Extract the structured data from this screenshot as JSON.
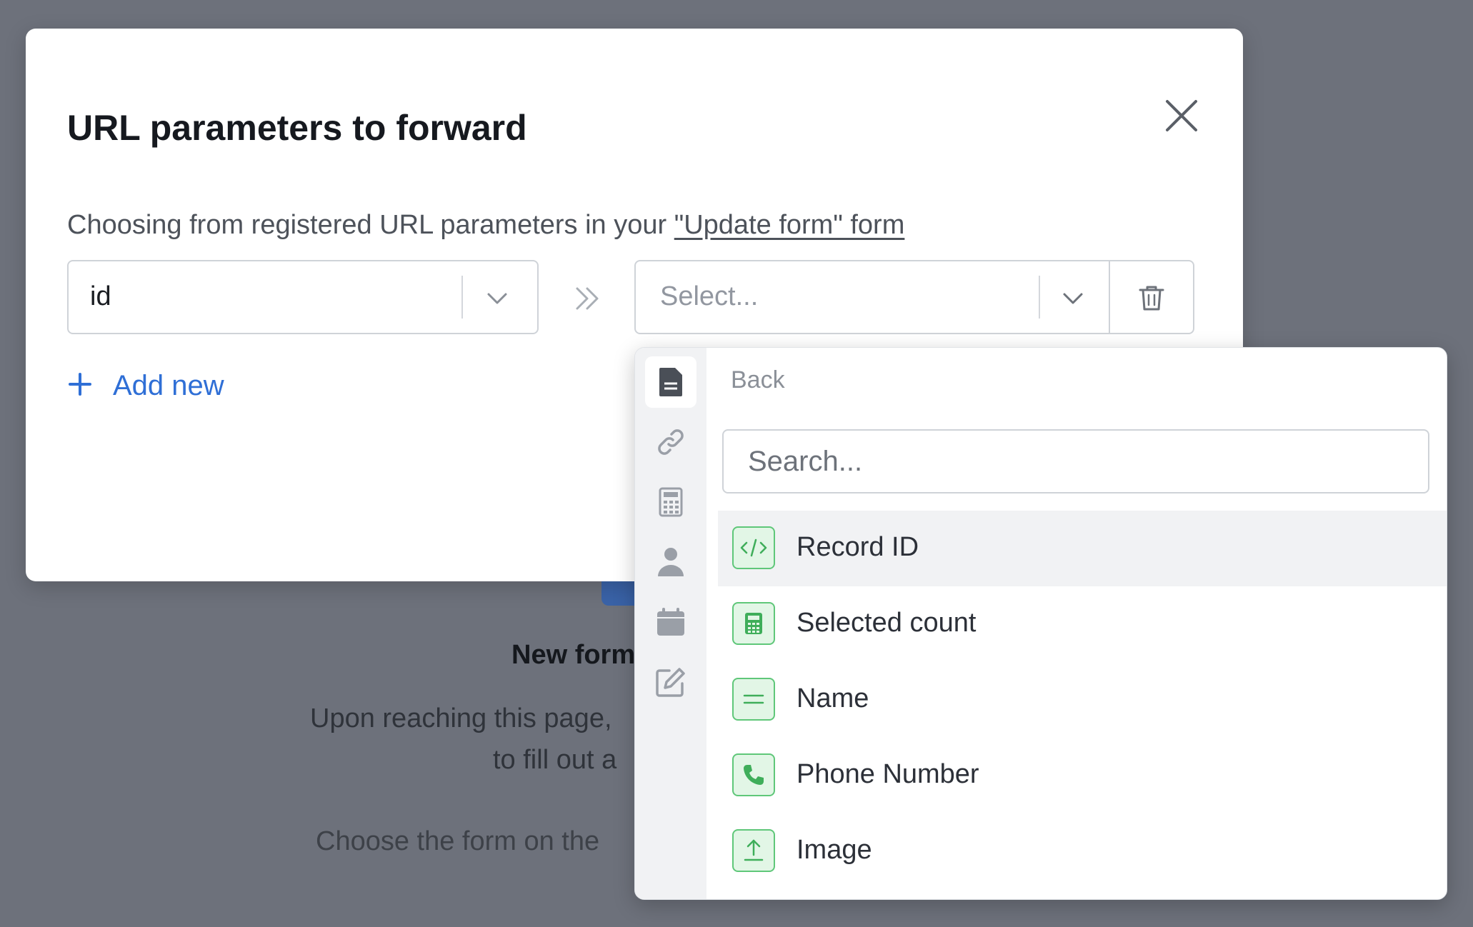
{
  "background": {
    "title": "New form",
    "description_line1": "Upon reaching this page,",
    "description_line2": "to fill out a",
    "description_line3": "Choose the form on the"
  },
  "modal": {
    "title": "URL parameters to forward",
    "description_prefix": "Choosing from registered URL parameters in your ",
    "description_link": "\"Update form\" form",
    "source_select_value": "id",
    "target_select_placeholder": "Select...",
    "add_new_label": "Add new"
  },
  "dropdown": {
    "back_label": "Back",
    "search_placeholder": "Search...",
    "rail_icons": [
      "document-icon",
      "link-icon",
      "calculator-icon",
      "person-icon",
      "calendar-icon",
      "edit-icon"
    ],
    "items": [
      {
        "label": "Record ID",
        "icon": "code-icon"
      },
      {
        "label": "Selected count",
        "icon": "calculator-icon"
      },
      {
        "label": "Name",
        "icon": "text-lines-icon"
      },
      {
        "label": "Phone Number",
        "icon": "phone-icon"
      },
      {
        "label": "Image",
        "icon": "upload-icon"
      }
    ]
  },
  "colors": {
    "overlay": "#6d717b",
    "link_blue": "#2f6fd6",
    "field_icon_green": "#5fc779",
    "field_icon_bg": "#e2f6e6"
  }
}
